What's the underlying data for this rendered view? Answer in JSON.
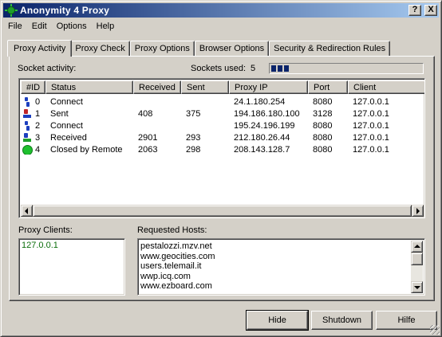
{
  "window": {
    "title": "Anonymity 4 Proxy"
  },
  "title_buttons": {
    "help": "?",
    "close": "X"
  },
  "menu": [
    "File",
    "Edit",
    "Options",
    "Help"
  ],
  "tabs": [
    "Proxy Activity",
    "Proxy Check",
    "Proxy Options",
    "Browser Options",
    "Security & Redirection Rules"
  ],
  "active_tab": "Proxy Activity",
  "socket": {
    "activity_label": "Socket activity:",
    "used_label": "Sockets used:",
    "used_value": "5",
    "meter_segments": 3
  },
  "table": {
    "columns": [
      "#ID",
      "Status",
      "Received",
      "Sent",
      "Proxy IP",
      "Port",
      "Client"
    ],
    "rows": [
      {
        "icon": "connect-icon",
        "id": "0",
        "status": "Connect",
        "received": "",
        "sent": "",
        "proxy_ip": "24.1.180.254",
        "port": "8080",
        "client": "127.0.0.1"
      },
      {
        "icon": "sent-icon",
        "id": "1",
        "status": "Sent",
        "received": "408",
        "sent": "375",
        "proxy_ip": "194.186.180.100",
        "port": "3128",
        "client": "127.0.0.1"
      },
      {
        "icon": "connect-icon",
        "id": "2",
        "status": "Connect",
        "received": "",
        "sent": "",
        "proxy_ip": "195.24.196.199",
        "port": "8080",
        "client": "127.0.0.1"
      },
      {
        "icon": "received-icon",
        "id": "3",
        "status": "Received",
        "received": "2901",
        "sent": "293",
        "proxy_ip": "212.180.26.44",
        "port": "8080",
        "client": "127.0.0.1"
      },
      {
        "icon": "closed-icon",
        "id": "4",
        "status": "Closed by Remote",
        "received": "2063",
        "sent": "298",
        "proxy_ip": "208.143.128.7",
        "port": "8080",
        "client": "127.0.0.1"
      }
    ]
  },
  "proxy_clients": {
    "label": "Proxy Clients:",
    "items": [
      "127.0.0.1"
    ]
  },
  "requested_hosts": {
    "label": "Requested Hosts:",
    "items": [
      "pestalozzi.mzv.net",
      "www.geocities.com",
      "users.telemail.it",
      "wwp.icq.com",
      "www.ezboard.com"
    ]
  },
  "buttons": {
    "hide": "Hide",
    "shutdown": "Shutdown",
    "hilfe": "Hilfe"
  },
  "colors": {
    "titlebar_start": "#0a246a",
    "titlebar_end": "#a6caf0",
    "face": "#d4d0c8"
  }
}
